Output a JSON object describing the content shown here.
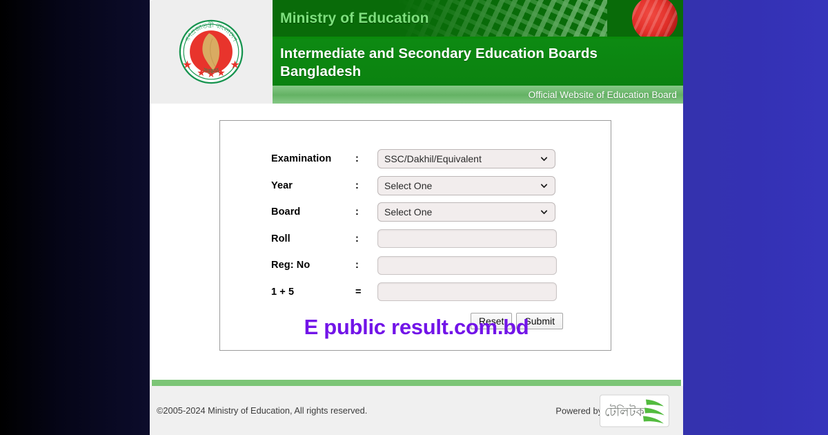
{
  "header": {
    "ministry_title": "Ministry of Education",
    "boards_title": "Intermediate and Secondary Education Boards Bangladesh",
    "official_note": "Official Website of Education Board",
    "seal": {
      "top_text": "গণপ্রজাতন্ত্রী বাংলাদেশ",
      "bottom_text": "সরকার"
    }
  },
  "form": {
    "rows": [
      {
        "label": "Examination",
        "sep": ":",
        "type": "select",
        "value": "SSC/Dakhil/Equivalent"
      },
      {
        "label": "Year",
        "sep": ":",
        "type": "select",
        "value": "Select One"
      },
      {
        "label": "Board",
        "sep": ":",
        "type": "select",
        "value": "Select One"
      },
      {
        "label": "Roll",
        "sep": ":",
        "type": "text",
        "value": ""
      },
      {
        "label": "Reg: No",
        "sep": ":",
        "type": "text",
        "value": ""
      },
      {
        "label": "1 + 5",
        "sep": "=",
        "type": "text",
        "value": ""
      }
    ],
    "reset_label": "Reset",
    "submit_label": "Submit"
  },
  "watermark": "E public result.com.bd",
  "footer": {
    "copyright": "©2005-2024 Ministry of Education, All rights reserved.",
    "powered_by": "Powered by",
    "teletalk_logo_text": "টেলিটক"
  },
  "colors": {
    "header_dark_green": "#096b09",
    "header_green": "#0b8a13",
    "light_green_band": "#64b264",
    "footer_rule_green": "#7cc576",
    "watermark_purple": "#7214e8",
    "gutter_blue": "#3431b4",
    "seal_green": "#17944f",
    "seal_red": "#e8342c"
  }
}
